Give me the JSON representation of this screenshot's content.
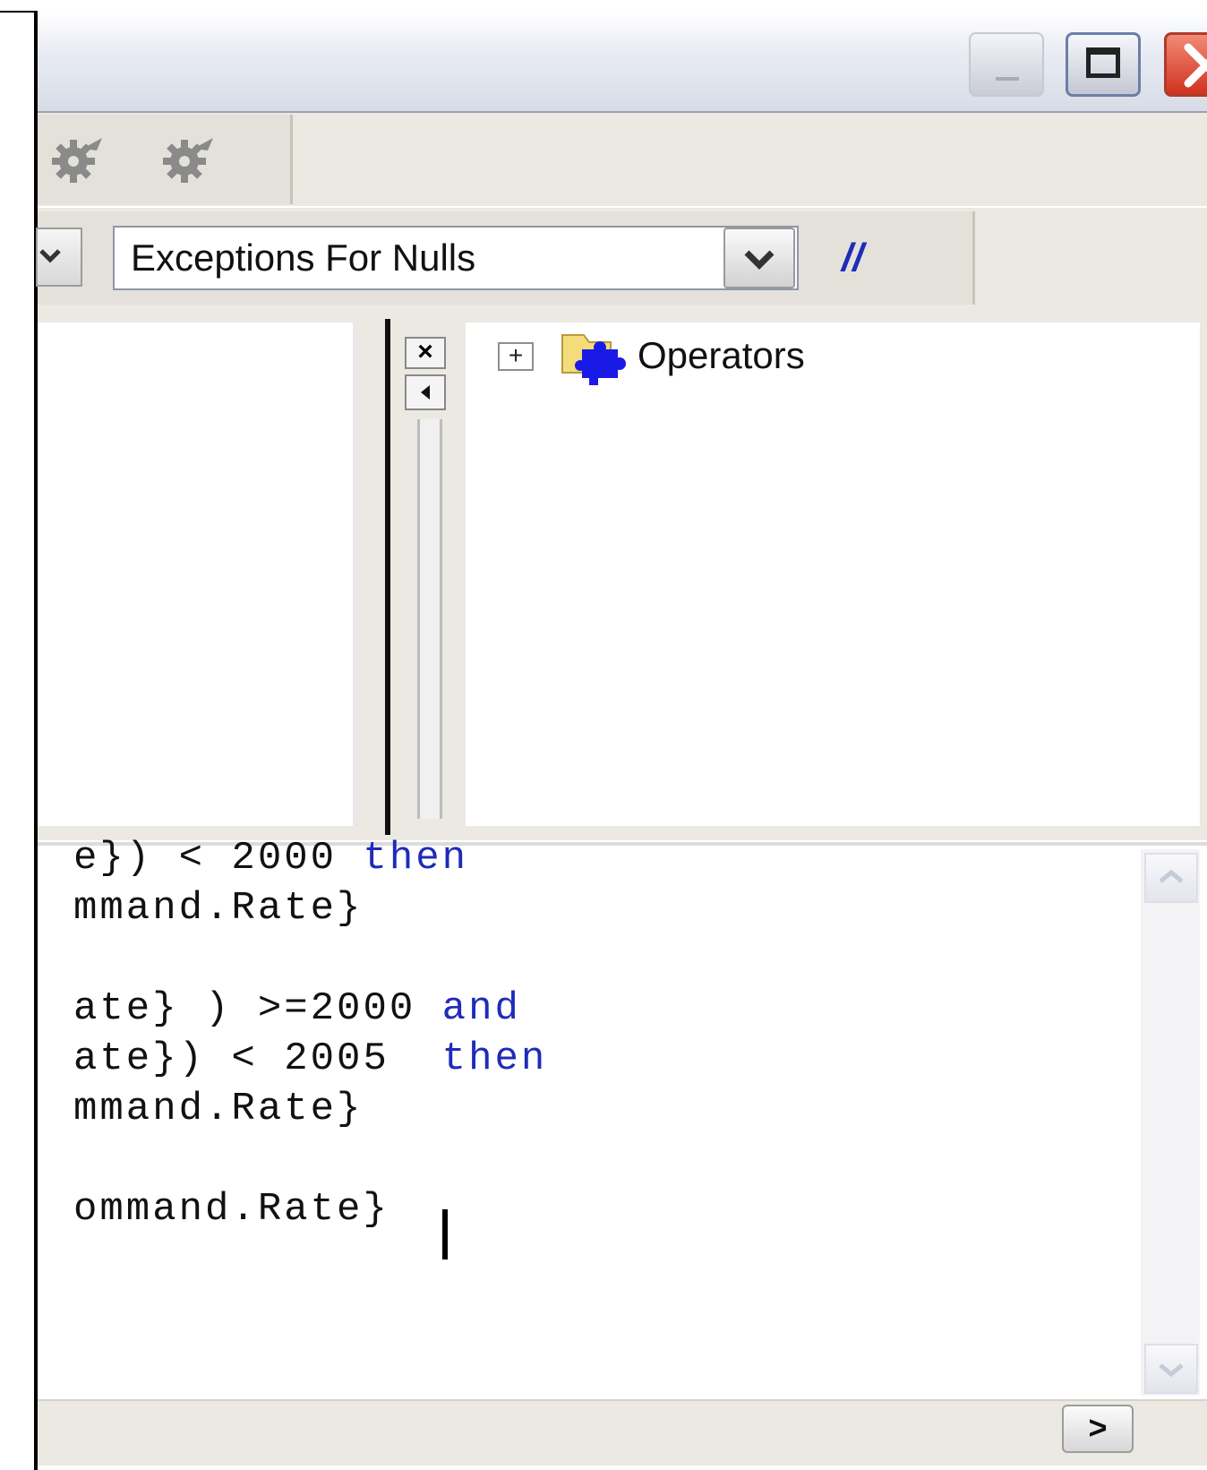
{
  "toolbar": {
    "combo_value": "Exceptions For Nulls",
    "comment_label": "//"
  },
  "tree": {
    "expand_glyph": "+",
    "items": [
      {
        "label": "Operators"
      }
    ]
  },
  "editor": {
    "lines": [
      {
        "text": "e}) < 2000 ",
        "keyword": "then"
      },
      {
        "text": "mmand.Rate}",
        "keyword": ""
      },
      {
        "text": "ate} ) >=2000 ",
        "keyword": "and"
      },
      {
        "text": "ate}) < 2005  ",
        "keyword": "then"
      },
      {
        "text": "mmand.Rate}",
        "keyword": ""
      },
      {
        "text": "ommand.Rate}",
        "keyword": ""
      }
    ]
  },
  "pane": {
    "close_glyph": "×"
  },
  "hscroll": {
    "right_glyph": ">"
  },
  "colors": {
    "keyword": "#1f2bb8",
    "close_button": "#d0321e"
  },
  "icons": [
    "gear-icon",
    "minimize-icon",
    "maximize-icon",
    "close-icon",
    "chevron-down-icon",
    "folder-icon",
    "puzzle-icon"
  ]
}
